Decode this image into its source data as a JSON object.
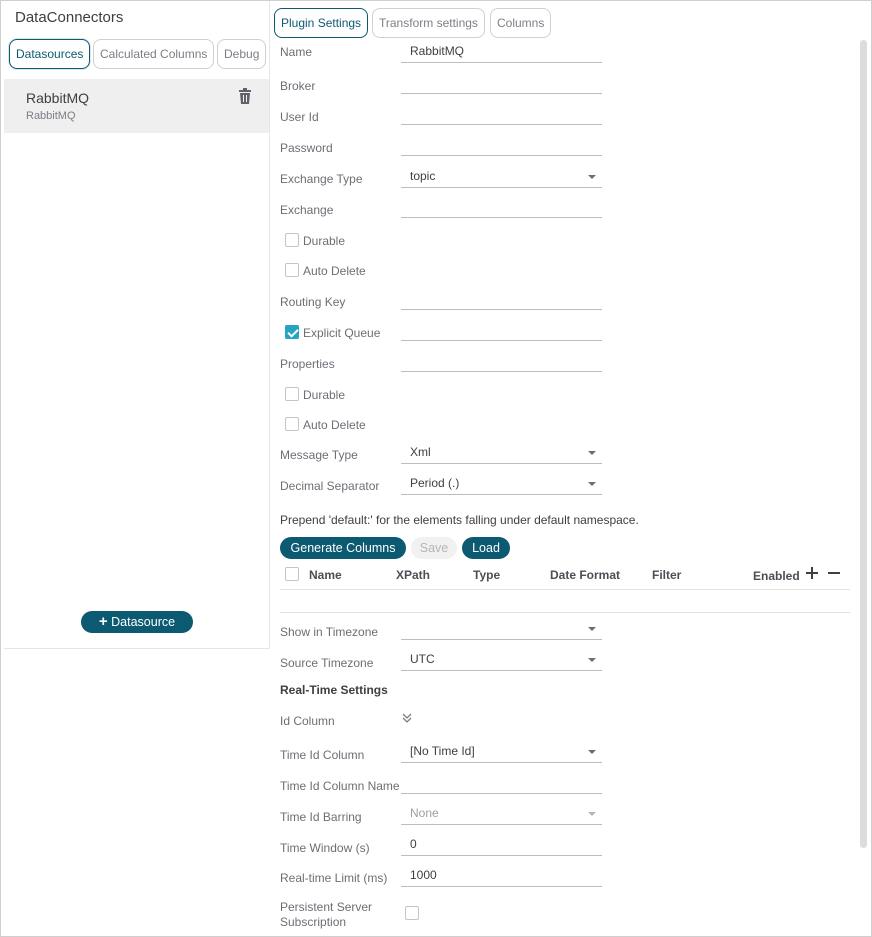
{
  "left": {
    "title": "DataConnectors",
    "tabs": [
      "Datasources",
      "Calculated Columns",
      "Debug"
    ],
    "datasource": {
      "name": "RabbitMQ",
      "type": "RabbitMQ"
    },
    "add_button": "Datasource"
  },
  "tabs": [
    "Plugin Settings",
    "Transform settings",
    "Columns"
  ],
  "form": {
    "name_label": "Name",
    "name_value": "RabbitMQ",
    "broker_label": "Broker",
    "broker_value": "",
    "userid_label": "User Id",
    "userid_value": "",
    "password_label": "Password",
    "password_value": "",
    "exchange_type_label": "Exchange Type",
    "exchange_type_value": "topic",
    "exchange_label": "Exchange",
    "exchange_value": "",
    "durable_label": "Durable",
    "durable_checked": false,
    "autodelete_label": "Auto Delete",
    "autodelete_checked": false,
    "routing_key_label": "Routing Key",
    "routing_key_value": "",
    "explicit_queue_label": "Explicit Queue",
    "explicit_queue_checked": true,
    "explicit_queue_value": "",
    "properties_label": "Properties",
    "properties_value": "",
    "durable2_label": "Durable",
    "durable2_checked": false,
    "autodelete2_label": "Auto Delete",
    "autodelete2_checked": false,
    "message_type_label": "Message Type",
    "message_type_value": "Xml",
    "decimal_sep_label": "Decimal Separator",
    "decimal_sep_value": "Period (.)"
  },
  "note": "Prepend 'default:' for the elements falling under default namespace.",
  "buttons": {
    "generate": "Generate Columns",
    "save": "Save",
    "load": "Load"
  },
  "table": {
    "headers": [
      "Name",
      "XPath",
      "Type",
      "Date Format",
      "Filter",
      "Enabled"
    ]
  },
  "tz": {
    "show_label": "Show in Timezone",
    "show_value": "",
    "source_label": "Source Timezone",
    "source_value": "UTC"
  },
  "realtime": {
    "title": "Real-Time Settings",
    "id_column_label": "Id Column",
    "time_id_label": "Time Id Column",
    "time_id_value": "[No Time Id]",
    "time_id_name_label": "Time Id Column Name",
    "time_id_name_value": "",
    "barring_label": "Time Id Barring",
    "barring_value": "None",
    "window_label": "Time Window (s)",
    "window_value": "0",
    "limit_label": "Real-time Limit (ms)",
    "limit_value": "1000",
    "persistent_label_1": "Persistent Server",
    "persistent_label_2": "Subscription",
    "persistent_checked": false
  }
}
